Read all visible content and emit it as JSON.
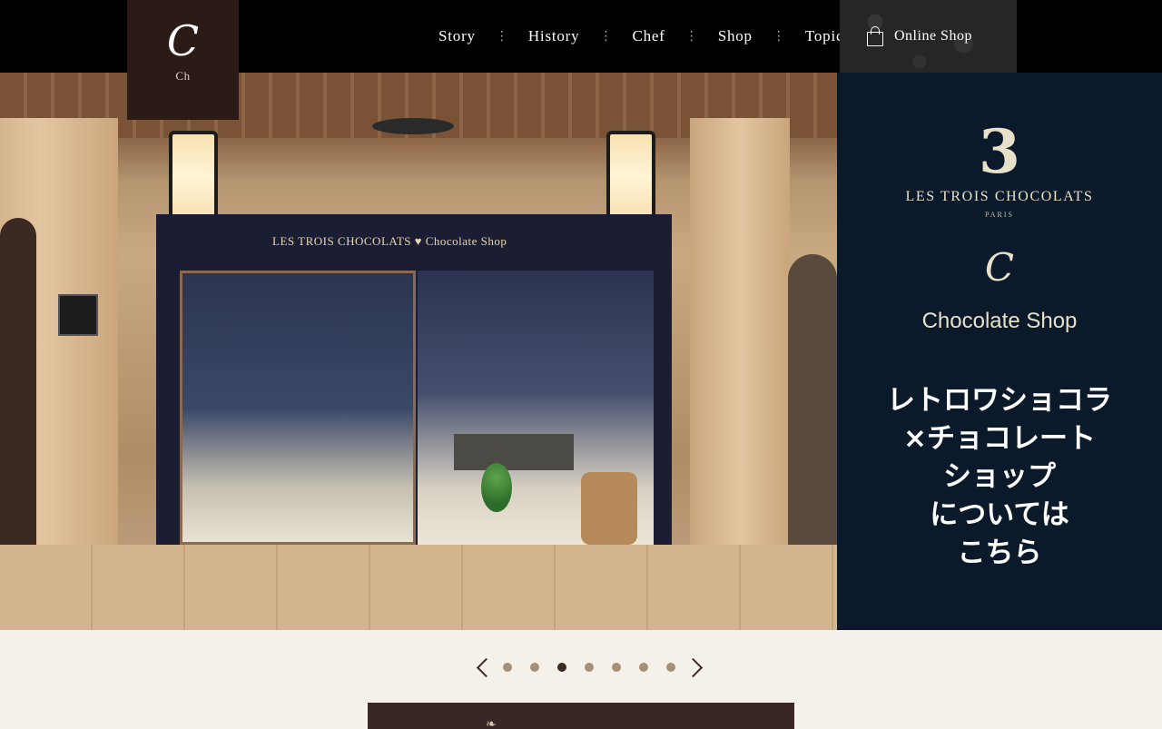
{
  "header": {
    "logo": {
      "mark": "C",
      "subtitle": "Ch"
    },
    "nav": [
      {
        "label": "Story"
      },
      {
        "label": "History"
      },
      {
        "label": "Chef"
      },
      {
        "label": "Shop"
      },
      {
        "label": "Topic"
      }
    ],
    "nav_separator": "⋮",
    "online_shop": {
      "label": "Online Shop",
      "icon": "shopping-bag-icon"
    }
  },
  "hero": {
    "sign_text": "LES TROIS CHOCOLATS  ♥  Chocolate Shop"
  },
  "banner": {
    "numeral": "3",
    "brand": "LES TROIS CHOCOLATS",
    "city": "PARIS",
    "mark": "C",
    "shop_name": "Chocolate Shop",
    "lines": [
      "レトロワショコラ",
      "×チョコレート",
      "ショップ",
      "については",
      "こちら"
    ]
  },
  "carousel": {
    "dot_count": 7,
    "active_index": 2
  },
  "colors": {
    "header_bg": "#000000",
    "banner_bg": "#0b1a2a",
    "page_bg": "#f4f0ea",
    "accent_dark": "#3a2723"
  }
}
